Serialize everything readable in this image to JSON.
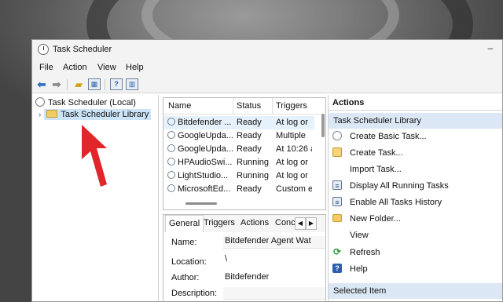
{
  "window": {
    "title": "Task Scheduler"
  },
  "menu": [
    "File",
    "Action",
    "View",
    "Help"
  ],
  "tree": {
    "root": "Task Scheduler (Local)",
    "library": "Task Scheduler Library"
  },
  "tasks": {
    "columns": [
      "Name",
      "Status",
      "Triggers"
    ],
    "rows": [
      {
        "name": "Bitdefender ...",
        "status": "Ready",
        "trigger": "At log or"
      },
      {
        "name": "GoogleUpda...",
        "status": "Ready",
        "trigger": "Multiple"
      },
      {
        "name": "GoogleUpda...",
        "status": "Ready",
        "trigger": "At 10:26 a"
      },
      {
        "name": "HPAudioSwi...",
        "status": "Running",
        "trigger": "At log or"
      },
      {
        "name": "LightStudio...",
        "status": "Running",
        "trigger": "At log or"
      },
      {
        "name": "MicrosoftEd...",
        "status": "Ready",
        "trigger": "Custom e"
      }
    ]
  },
  "details": {
    "tabs": [
      "General",
      "Triggers",
      "Actions",
      "Conc"
    ],
    "fields": [
      {
        "label": "Name:",
        "value": "Bitdefender Agent Wat"
      },
      {
        "label": "Location:",
        "value": "\\"
      },
      {
        "label": "Author:",
        "value": "Bitdefender"
      },
      {
        "label": "Description:",
        "value": ""
      }
    ]
  },
  "actions": {
    "header": "Actions",
    "section": "Task Scheduler Library",
    "items": [
      {
        "label": "Create Basic Task...",
        "icon": "clock-icon"
      },
      {
        "label": "Create Task...",
        "icon": "task-icon"
      },
      {
        "label": "Import Task...",
        "icon": ""
      },
      {
        "label": "Display All Running Tasks",
        "icon": "list-icon"
      },
      {
        "label": "Enable All Tasks History",
        "icon": "history-icon"
      },
      {
        "label": "New Folder...",
        "icon": "folder-icon"
      },
      {
        "label": "View",
        "icon": ""
      },
      {
        "label": "Refresh",
        "icon": "refresh-icon"
      },
      {
        "label": "Help",
        "icon": "help-icon"
      }
    ],
    "footer": "Selected Item"
  }
}
